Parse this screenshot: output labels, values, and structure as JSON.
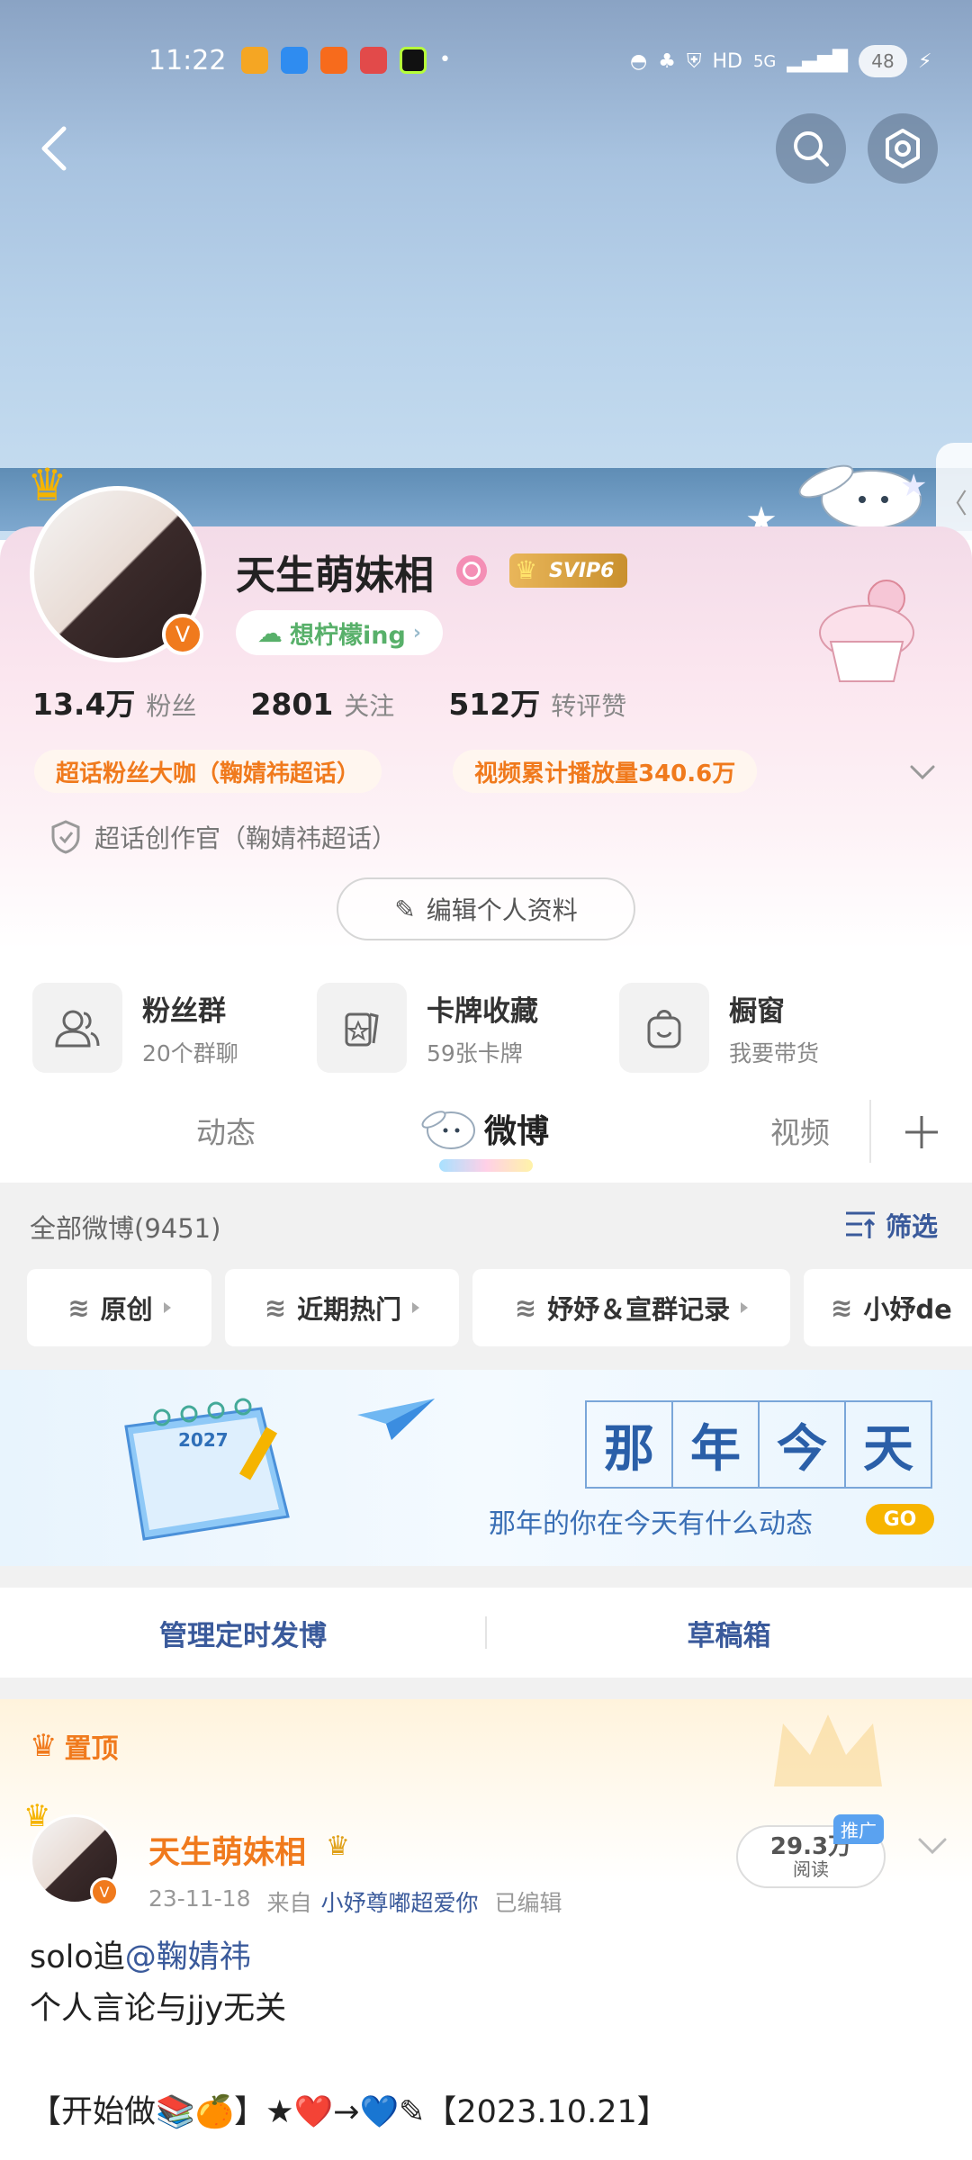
{
  "status_bar": {
    "time": "11:22",
    "network": "5G",
    "battery": "48"
  },
  "profile": {
    "name": "天生萌妹相",
    "vip": "SVIP6",
    "mood": "想柠檬ing",
    "stats": [
      {
        "num": "13.4万",
        "label": "粉丝"
      },
      {
        "num": "2801",
        "label": "关注"
      },
      {
        "num": "512万",
        "label": "转评赞"
      }
    ],
    "tags": [
      "超话粉丝大咖（鞠婧祎超话）",
      "视频累计播放量340.6万"
    ],
    "badge": "超话创作官（鞠婧祎超话）",
    "edit_button": "编辑个人资料"
  },
  "functions": [
    {
      "title": "粉丝群",
      "sub": "20个群聊",
      "icon": "fans-group-icon"
    },
    {
      "title": "卡牌收藏",
      "sub": "59张卡牌",
      "icon": "card-icon"
    },
    {
      "title": "橱窗",
      "sub": "我要带货",
      "icon": "shop-bag-icon"
    }
  ],
  "tabs": {
    "dynamic": "动态",
    "weibo": "微博",
    "video": "视频"
  },
  "filter": {
    "all_label": "全部微博(9451)",
    "filter_button": "筛选",
    "chips": [
      "原创",
      "近期热门",
      "妤妤＆宣群记录",
      "小妤de"
    ]
  },
  "banner": {
    "big_text": [
      "那",
      "年",
      "今",
      "天"
    ],
    "sub_text": "那年的你在今天有什么动态",
    "go": "GO",
    "calendar_year": "2027"
  },
  "actions": {
    "scheduled": "管理定时发博",
    "drafts": "草稿箱"
  },
  "pinned_label": "置顶",
  "post": {
    "author": "天生萌妹相",
    "date": "23-11-18",
    "from_label": "来自",
    "source": "小妤尊嘟超爱你",
    "edited": "已编辑",
    "reads_num": "29.3万",
    "reads_label": "阅读",
    "promote": "推广",
    "line1_prefix": "solo追",
    "line1_mention": "@鞠婧祎",
    "line2": "个人言论与jjy无关",
    "line3": "【开始做📚🍊】★❤️→💙✎【2023.10.21】"
  },
  "colors": {
    "accent_orange": "#f07a1d",
    "link_blue": "#3a5a9b",
    "sky_blue": "#a8c3e0",
    "pink_card": "#fbe6ef"
  }
}
